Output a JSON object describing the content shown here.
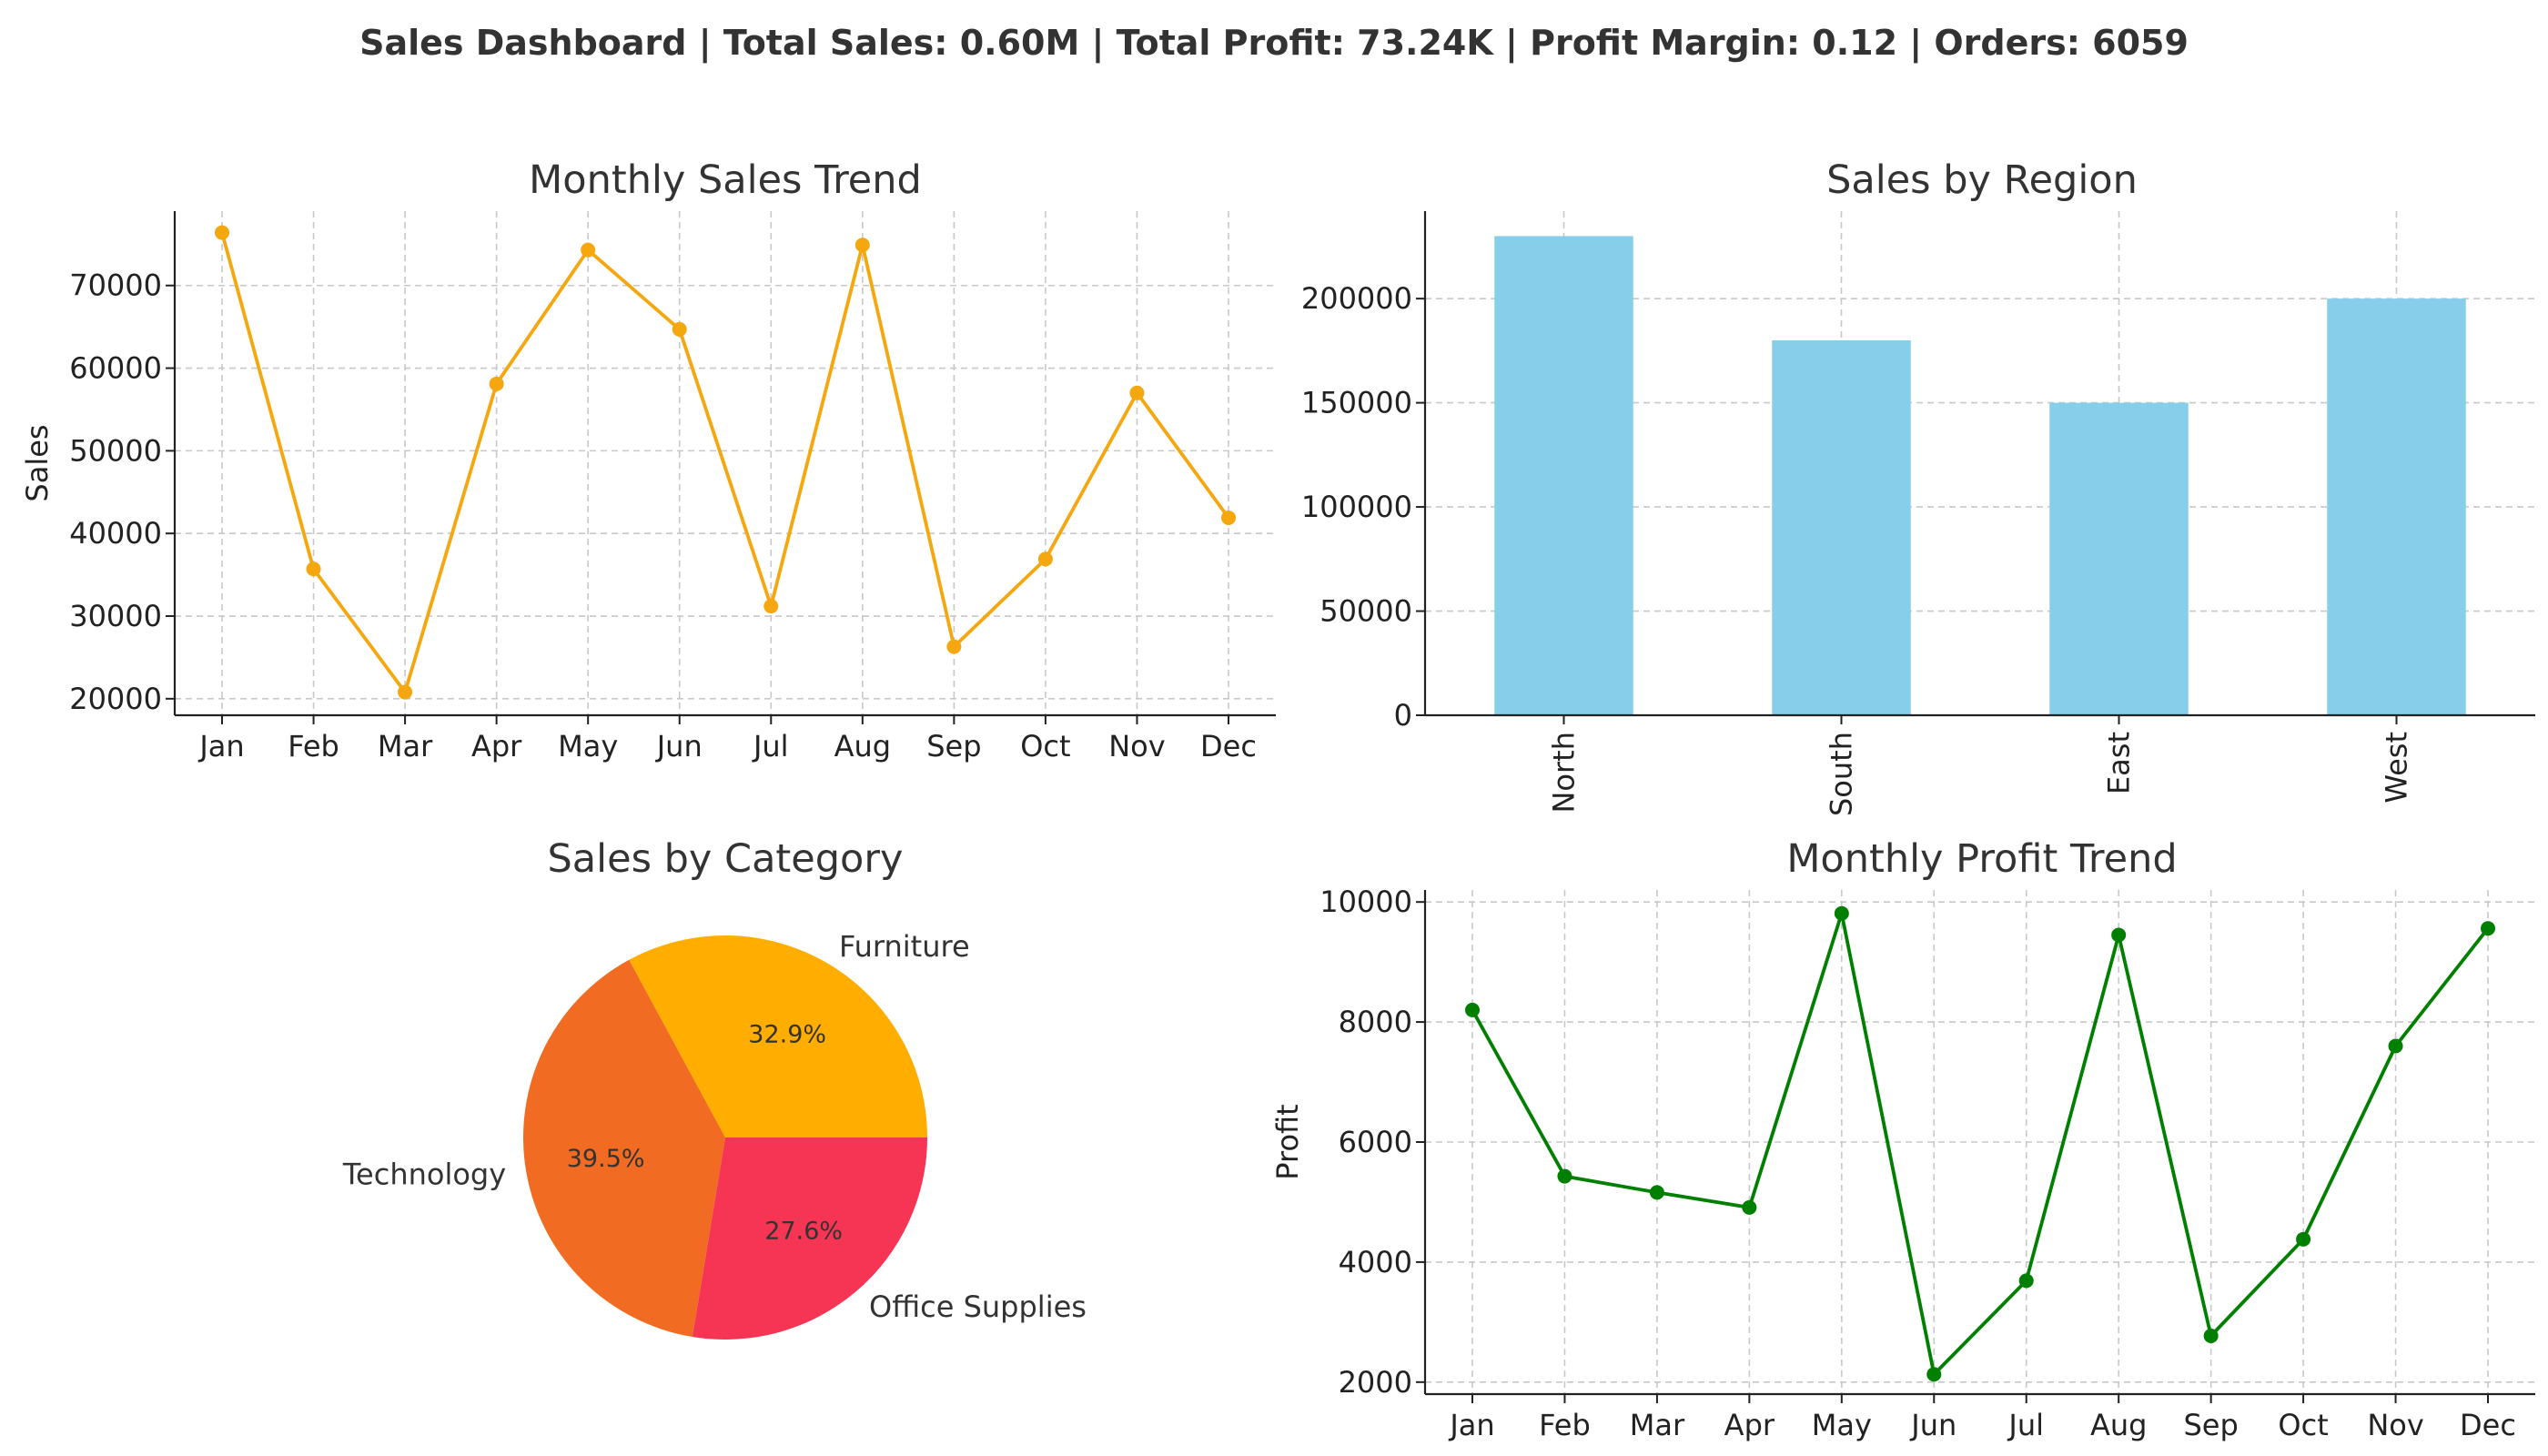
{
  "dashboard": {
    "title": "Sales Dashboard | Total Sales: 0.60M | Total Profit: 73.24K | Profit Margin: 0.12 | Orders: 6059"
  },
  "chart_data": [
    {
      "id": "sales-trend",
      "type": "line",
      "title": "Monthly Sales Trend",
      "xlabel": "",
      "ylabel": "Sales",
      "categories": [
        "Jan",
        "Feb",
        "Mar",
        "Apr",
        "May",
        "Jun",
        "Jul",
        "Aug",
        "Sep",
        "Oct",
        "Nov",
        "Dec"
      ],
      "values": [
        76400,
        35700,
        20800,
        58100,
        74300,
        64700,
        31200,
        74900,
        26300,
        36900,
        57000,
        41900
      ],
      "ylim": [
        18000,
        79000
      ],
      "yticks": [
        20000,
        30000,
        40000,
        50000,
        60000,
        70000
      ],
      "color": "#F5A70F",
      "grid": true
    },
    {
      "id": "sales-region",
      "type": "bar",
      "title": "Sales by Region",
      "xlabel": "",
      "ylabel": "",
      "categories": [
        "North",
        "South",
        "East",
        "West"
      ],
      "values": [
        230000,
        180000,
        150000,
        200000
      ],
      "ylim": [
        0,
        242000
      ],
      "yticks": [
        0,
        50000,
        100000,
        150000,
        200000
      ],
      "color": "#87CEEB",
      "grid": true
    },
    {
      "id": "sales-category",
      "type": "pie",
      "title": "Sales by Category",
      "slices": [
        {
          "label": "Furniture",
          "value": 32.9,
          "pct_label": "32.9%",
          "color": "#FFAE00"
        },
        {
          "label": "Technology",
          "value": 39.5,
          "pct_label": "39.5%",
          "color": "#F26B22"
        },
        {
          "label": "Office Supplies",
          "value": 27.6,
          "pct_label": "27.6%",
          "color": "#F63454"
        }
      ]
    },
    {
      "id": "profit-trend",
      "type": "line",
      "title": "Monthly Profit Trend",
      "xlabel": "",
      "ylabel": "Profit",
      "categories": [
        "Jan",
        "Feb",
        "Mar",
        "Apr",
        "May",
        "Jun",
        "Jul",
        "Aug",
        "Sep",
        "Oct",
        "Nov",
        "Dec"
      ],
      "values": [
        8200,
        5430,
        5160,
        4910,
        9810,
        2130,
        3690,
        9450,
        2770,
        4380,
        7600,
        9560
      ],
      "ylim": [
        1800,
        10200
      ],
      "yticks": [
        2000,
        4000,
        6000,
        8000,
        10000
      ],
      "color": "#007F00",
      "grid": true
    }
  ]
}
